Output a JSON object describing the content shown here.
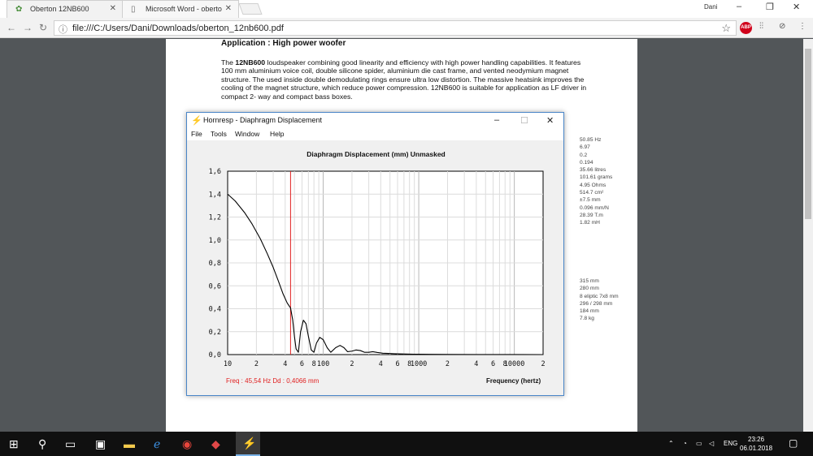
{
  "browser": {
    "tabs": [
      {
        "label": "Oberton 12NB600"
      },
      {
        "label": "Microsoft Word - oberto"
      }
    ],
    "user": "Dani",
    "url": "file:///C:/Users/Dani/Downloads/oberton_12nb600.pdf",
    "abp_badge": "ABP"
  },
  "pdf": {
    "heading": "Application : High power woofer",
    "paragraph_lead": "The ",
    "paragraph_bold": "12NB600",
    "paragraph_rest": " loudspeaker combining good linearity and efficiency with high power handling capabilities. It features 100 mm aluminium voice coil, double silicone spider, aluminium die cast frame, and vented neodymium magnet structure. The used inside double demodulating rings ensure ultra low distortion. The massive heatsink improves the cooling of the magnet structure, which reduce power compression. 12NB600 is suitable for application as LF driver in compact 2- way and compact bass boxes.",
    "specs_top": [
      "50.85 Hz",
      "6.97",
      "0.2",
      "0.194",
      "35.66 litres",
      "101.61 grams",
      "4.95 Ohms",
      "514.7 cm²",
      "±7.5 mm",
      "0.096 mm/N",
      "28.39 T.m",
      "1.82 mH"
    ],
    "specs_bottom": [
      "315 mm",
      "280 mm",
      "8 eliptic 7x8 mm",
      "296 / 298 mm",
      "184 mm",
      "7.8 kg"
    ]
  },
  "hornresp": {
    "window_title": "Hornresp - Diaphragm Displacement",
    "menu": [
      "File",
      "Tools",
      "Window",
      "Help"
    ],
    "readout": "Freq : 45,54 Hz    Dd : 0,4066 mm",
    "x_axis_label": "Frequency (hertz)"
  },
  "chart_data": {
    "type": "line",
    "title": "Diaphragm Displacement (mm)   Unmasked",
    "xlabel": "Frequency (hertz)",
    "ylabel": "",
    "x_scale": "log",
    "xlim": [
      10,
      20000
    ],
    "ylim": [
      0,
      1.6
    ],
    "y_ticks": [
      "0,0",
      "0,2",
      "0,4",
      "0,6",
      "0,8",
      "1,0",
      "1,2",
      "1,4",
      "1,6"
    ],
    "x_ticks": [
      {
        "v": 10,
        "label": "10"
      },
      {
        "v": 20,
        "label": "2"
      },
      {
        "v": 40,
        "label": "4"
      },
      {
        "v": 60,
        "label": "6"
      },
      {
        "v": 80,
        "label": "8"
      },
      {
        "v": 100,
        "label": "100"
      },
      {
        "v": 200,
        "label": "2"
      },
      {
        "v": 400,
        "label": "4"
      },
      {
        "v": 600,
        "label": "6"
      },
      {
        "v": 800,
        "label": "8"
      },
      {
        "v": 1000,
        "label": "1000"
      },
      {
        "v": 2000,
        "label": "2"
      },
      {
        "v": 4000,
        "label": "4"
      },
      {
        "v": 6000,
        "label": "6"
      },
      {
        "v": 8000,
        "label": "8"
      },
      {
        "v": 10000,
        "label": "10000"
      },
      {
        "v": 20000,
        "label": "2"
      }
    ],
    "grid": true,
    "cursor_x": 45.54,
    "series": [
      {
        "x": [
          10,
          12,
          15,
          18,
          22,
          26,
          30,
          34,
          38,
          42,
          45.54,
          48,
          50,
          52,
          55,
          58,
          62,
          66,
          70,
          75,
          80,
          85,
          92,
          100,
          110,
          120,
          135,
          150,
          165,
          180,
          200,
          220,
          245,
          270,
          300,
          330,
          370,
          420,
          480,
          550,
          650,
          800,
          1000,
          1300,
          2000,
          4000,
          10000,
          20000
        ],
        "y": [
          1.4,
          1.34,
          1.24,
          1.14,
          1.01,
          0.88,
          0.76,
          0.64,
          0.53,
          0.45,
          0.4066,
          0.3,
          0.16,
          0.05,
          0.02,
          0.2,
          0.3,
          0.27,
          0.16,
          0.04,
          0.02,
          0.1,
          0.15,
          0.13,
          0.06,
          0.02,
          0.06,
          0.08,
          0.06,
          0.025,
          0.03,
          0.04,
          0.035,
          0.02,
          0.02,
          0.025,
          0.018,
          0.012,
          0.01,
          0.008,
          0.006,
          0.004,
          0.003,
          0.002,
          0.001,
          0.0005,
          0.0002,
          0.0001
        ]
      }
    ]
  },
  "taskbar": {
    "language": "ENG",
    "time": "23:26",
    "date": "06.01.2018"
  }
}
